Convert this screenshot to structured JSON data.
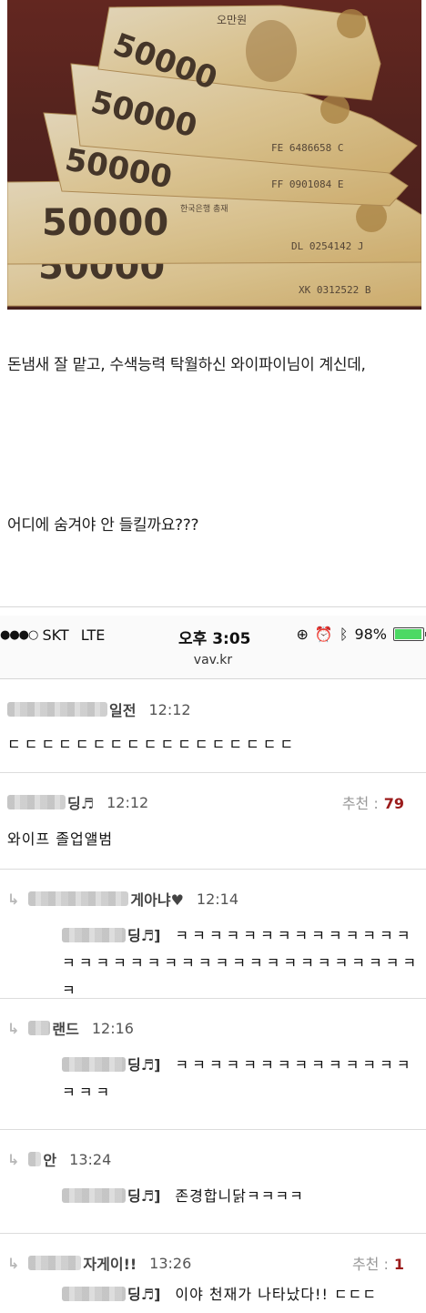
{
  "caption": {
    "line1": "돈냄새 잘 맡고, 수색능력 탁월하신 와이파이님이 계신데,",
    "line2": "어디에 숨겨야 안 들킬까요???"
  },
  "photo": {
    "banknote_values": [
      "50000",
      "50000",
      "50000",
      "50000",
      "50000"
    ],
    "serial_1": "FE 6486658 C",
    "serial_2": "FF 0901084 E",
    "serial_3": "DL 0254142 J",
    "serial_4": "XK 0312522 B",
    "bank_label": "한국은행 총재",
    "note_label": "오만원"
  },
  "statusbar": {
    "signal_dots": "●●●○",
    "carrier": "SKT",
    "network": "LTE",
    "time": "오후 3:05",
    "url": "vav.kr",
    "battery_text": "98%",
    "battery_level": 0.98,
    "icons": [
      "lock-rotation-icon",
      "alarm-icon",
      "bluetooth-icon"
    ]
  },
  "comments": [
    {
      "nick_suffix": "일전",
      "time": "12:12",
      "body": "ㄷㄷㄷㄷㄷㄷㄷㄷㄷㄷㄷㄷㄷㄷㄷㄷㄷ"
    },
    {
      "nick_suffix": "딩♬",
      "time": "12:12",
      "rec_label": "추천 :",
      "rec_count": "79",
      "body": "와이프 졸업앨범"
    },
    {
      "nick_suffix": "게아냐♥",
      "time": "12:14",
      "mention": "딩♬]",
      "body": "ㅋㅋㅋㅋㅋㅋㅋㅋㅋㅋㅋㅋㅋㅋㅋㅋㅋㅋㅋㅋㅋㅋㅋㅋㅋㅋㅋㅋㅋㅋㅋㅋㅋㅋㅋㅋ"
    },
    {
      "nick_suffix": "랜드",
      "time": "12:16",
      "mention": "딩♬]",
      "body": "ㅋㅋㅋㅋㅋㅋㅋㅋㅋㅋㅋㅋㅋㅋㅋㅋㅋ"
    },
    {
      "nick_suffix": "안",
      "time": "13:24",
      "mention": "딩♬]",
      "body": "존경합니닭ㅋㅋㅋㅋ"
    },
    {
      "nick_suffix": "자게이!!",
      "time": "13:26",
      "rec_label": "추천 :",
      "rec_count": "1",
      "mention": "딩♬]",
      "body": "이야 천재가 나타났다!! ㄷㄷㄷ"
    }
  ],
  "colors": {
    "recommend_count": "#9b1b1b",
    "battery_green": "#4cd964",
    "reply_arrow": "#b9b9b9"
  }
}
